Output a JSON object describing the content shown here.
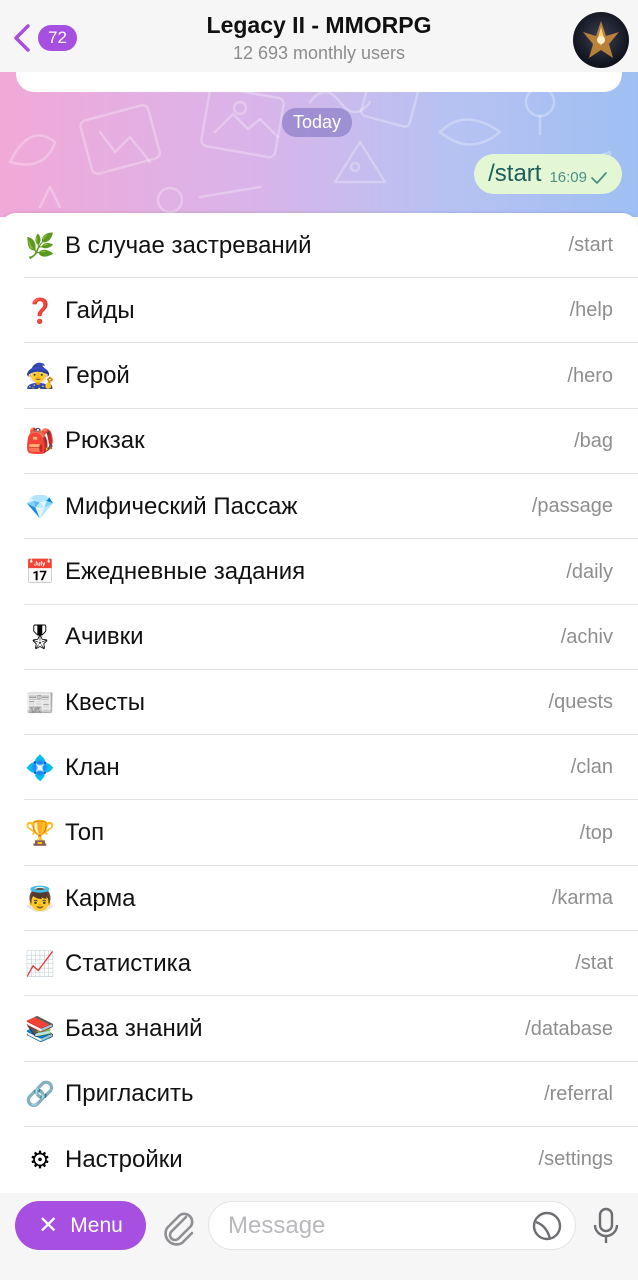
{
  "header": {
    "back_count": "72",
    "title": "Legacy II - MMORPG",
    "subtitle": "12 693 monthly users",
    "avatar_icon": "game-emblem-icon"
  },
  "chat": {
    "date_label": "Today",
    "message": {
      "text": "/start",
      "time": "16:09",
      "status_icon": "check-icon"
    }
  },
  "commands": [
    {
      "emoji": "🌿",
      "icon": "herb-icon",
      "label": "В случае застреваний",
      "command": "/start"
    },
    {
      "emoji": "❓",
      "icon": "question-icon",
      "label": "Гайды",
      "command": "/help"
    },
    {
      "emoji": "🧙",
      "icon": "mage-icon",
      "label": "Герой",
      "command": "/hero"
    },
    {
      "emoji": "🎒",
      "icon": "backpack-icon",
      "label": "Рюкзак",
      "command": "/bag"
    },
    {
      "emoji": "💎",
      "icon": "gem-icon",
      "label": "Мифический Пассаж",
      "command": "/passage"
    },
    {
      "emoji": "📅",
      "icon": "calendar-icon",
      "label": "Ежедневные задания",
      "command": "/daily"
    },
    {
      "emoji": "🎖",
      "icon": "medal-icon",
      "label": "Ачивки",
      "command": "/achiv"
    },
    {
      "emoji": "📰",
      "icon": "newspaper-icon",
      "label": "Квесты",
      "command": "/quests"
    },
    {
      "emoji": "💠",
      "icon": "diamond-shape-icon",
      "label": "Клан",
      "command": "/clan"
    },
    {
      "emoji": "🏆",
      "icon": "trophy-icon",
      "label": "Топ",
      "command": "/top"
    },
    {
      "emoji": "👼",
      "icon": "angel-icon",
      "label": "Карма",
      "command": "/karma"
    },
    {
      "emoji": "📈",
      "icon": "chart-increasing-icon",
      "label": "Статистика",
      "command": "/stat"
    },
    {
      "emoji": "📚",
      "icon": "books-icon",
      "label": "База знаний",
      "command": "/database"
    },
    {
      "emoji": "🔗",
      "icon": "link-icon",
      "label": "Пригласить",
      "command": "/referral"
    },
    {
      "emoji": "⚙",
      "icon": "gear-icon",
      "label": "Настройки",
      "command": "/settings"
    }
  ],
  "input": {
    "menu_label": "Menu",
    "placeholder": "Message"
  },
  "colors": {
    "accent": "#a64fe0",
    "outgoing_bubble": "#e3f7d4",
    "date_pill": "#8a7bc4"
  }
}
